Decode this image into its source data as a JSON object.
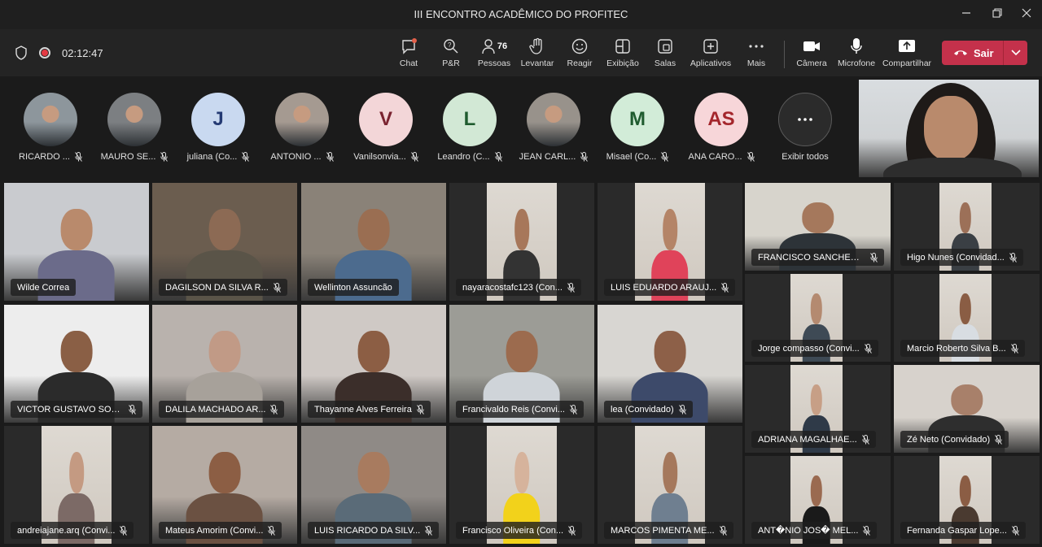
{
  "window": {
    "title": "III ENCONTRO ACADÊMICO DO PROFITEC"
  },
  "toolbar": {
    "timer": "02:12:47",
    "buttons": [
      {
        "id": "chat",
        "label": "Chat"
      },
      {
        "id": "qa",
        "label": "P&R"
      },
      {
        "id": "people",
        "label": "Pessoas",
        "count": "76"
      },
      {
        "id": "raise",
        "label": "Levantar"
      },
      {
        "id": "react",
        "label": "Reagir"
      },
      {
        "id": "view",
        "label": "Exibição"
      },
      {
        "id": "rooms",
        "label": "Salas"
      },
      {
        "id": "apps",
        "label": "Aplicativos"
      },
      {
        "id": "more",
        "label": "Mais"
      },
      {
        "id": "camera",
        "label": "Câmera"
      },
      {
        "id": "mic",
        "label": "Microfone"
      },
      {
        "id": "share",
        "label": "Compartilhar"
      }
    ],
    "leave_label": "Sair",
    "colors": {
      "leave": "#c4314b",
      "accent": "#8b8cf0"
    }
  },
  "strip": {
    "participants": [
      {
        "name": "RICARDO ...",
        "initials": "",
        "photo": true,
        "bg": "#8d969c"
      },
      {
        "name": "MAURO SE...",
        "initials": "",
        "photo": true,
        "bg": "#7c7f82"
      },
      {
        "name": "juliana (Co...",
        "initials": "J",
        "photo": false,
        "bg": "#c9d9f0",
        "fg": "#243a73"
      },
      {
        "name": "ANTONIO ...",
        "initials": "",
        "photo": true,
        "bg": "#a59a91"
      },
      {
        "name": "Vanilsonvia...",
        "initials": "V",
        "photo": false,
        "bg": "#f3d6d8",
        "fg": "#7a2330"
      },
      {
        "name": "Leandro (C...",
        "initials": "L",
        "photo": false,
        "bg": "#d2e8d5",
        "fg": "#1f5b2f"
      },
      {
        "name": "JEAN CARL...",
        "initials": "",
        "photo": true,
        "bg": "#98928b"
      },
      {
        "name": "Misael (Co...",
        "initials": "M",
        "photo": false,
        "bg": "#d2ecd8",
        "fg": "#1f5b2f"
      },
      {
        "name": "ANA CARO...",
        "initials": "AS",
        "photo": false,
        "bg": "#f7d6d9",
        "fg": "#a4262c"
      }
    ],
    "show_all_label": "Exibir todos"
  },
  "tiles": [
    {
      "name": "Wilde Correa",
      "muted": false
    },
    {
      "name": "DAGILSON DA SILVA R...",
      "muted": true
    },
    {
      "name": "Wellinton Assuncão",
      "muted": false
    },
    {
      "name": "nayaracostafc123 (Con...",
      "muted": true
    },
    {
      "name": "LUIS EDUARDO ARAUJ...",
      "muted": true
    },
    {
      "name": "FRANCISCO SANCHES ...",
      "muted": true
    },
    {
      "name": "Higo Nunes (Convidad...",
      "muted": true
    },
    {
      "name": "VICTOR GUSTAVO SOU...",
      "muted": true
    },
    {
      "name": "DALILA MACHADO AR...",
      "muted": true
    },
    {
      "name": "Thayanne Alves Ferreira",
      "muted": true
    },
    {
      "name": "Francivaldo Reis (Convi...",
      "muted": true
    },
    {
      "name": "lea (Convidado)",
      "muted": true
    },
    {
      "name": "Jorge compasso (Convi...",
      "muted": true
    },
    {
      "name": "Marcio Roberto Silva B...",
      "muted": true
    },
    {
      "name": "ADRIANA MAGALHAE...",
      "muted": true
    },
    {
      "name": "Zé Neto (Convidado)",
      "muted": true
    },
    {
      "name": "andreiajane.arq (Convi...",
      "muted": true
    },
    {
      "name": "Mateus Amorim (Convi...",
      "muted": true
    },
    {
      "name": "LUIS RICARDO DA SILV...",
      "muted": true
    },
    {
      "name": "Francisco Oliveira (Con...",
      "muted": true
    },
    {
      "name": "MARCOS PIMENTA ME...",
      "muted": true
    },
    {
      "name": "ANT�NIO JOS� MEL...",
      "muted": true
    },
    {
      "name": "Fernanda Gaspar Lope...",
      "muted": true
    }
  ]
}
